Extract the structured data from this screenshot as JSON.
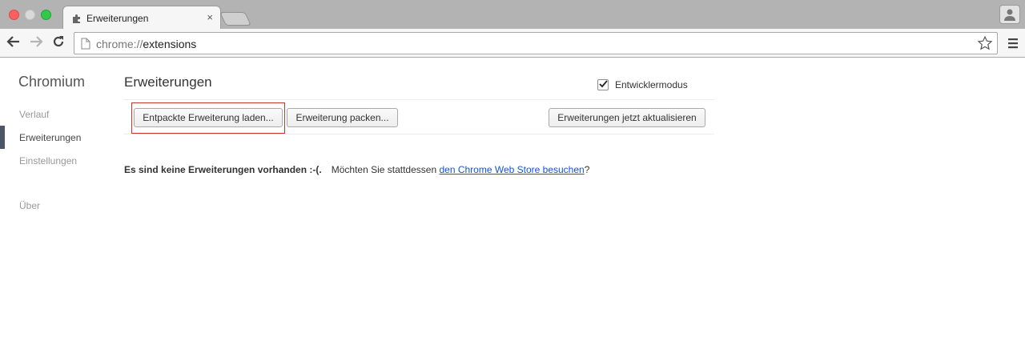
{
  "tab": {
    "title": "Erweiterungen",
    "close": "×"
  },
  "address_bar": {
    "scheme": "chrome://",
    "host": "extensions"
  },
  "sidebar": {
    "brand": "Chromium",
    "items": [
      {
        "label": "Verlauf",
        "active": false
      },
      {
        "label": "Erweiterungen",
        "active": true
      },
      {
        "label": "Einstellungen",
        "active": false
      },
      {
        "label": "Über",
        "active": false
      }
    ]
  },
  "main": {
    "title": "Erweiterungen",
    "developer_mode": {
      "label": "Entwicklermodus",
      "checked": true
    },
    "buttons": {
      "load_unpacked": "Entpackte Erweiterung laden...",
      "pack": "Erweiterung packen...",
      "update_now": "Erweiterungen jetzt aktualisieren"
    },
    "empty": {
      "bold": "Es sind keine Erweiterungen vorhanden :-(.",
      "prefix": "Möchten Sie stattdessen ",
      "link": "den Chrome Web Store besuchen",
      "suffix": "?"
    }
  },
  "colors": {
    "link": "#1155cc",
    "highlight": "#c0392b",
    "nav_indicator": "#4e5565"
  },
  "icons": [
    "puzzle-icon",
    "back-arrow-icon",
    "forward-arrow-icon",
    "reload-icon",
    "page-icon",
    "star-icon",
    "menu-icon",
    "profile-icon",
    "checkmark-icon"
  ]
}
